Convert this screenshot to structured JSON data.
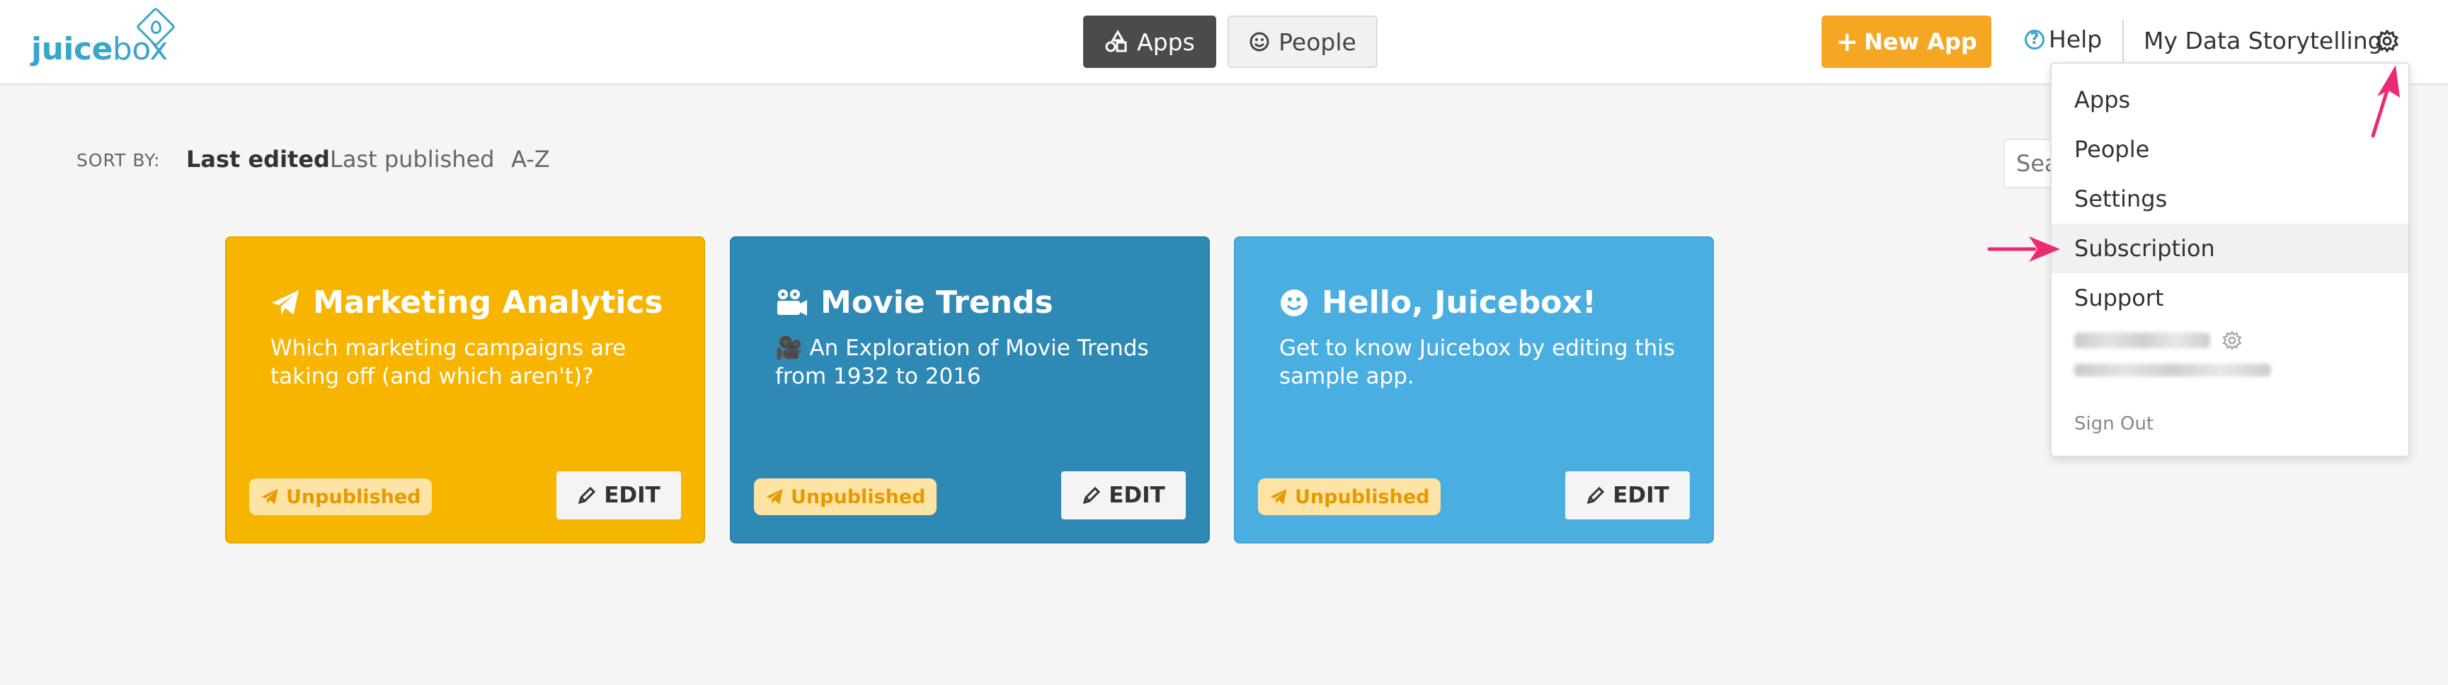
{
  "logo": {
    "part1": "juice",
    "part2": "box"
  },
  "nav": {
    "apps_label": "Apps",
    "people_label": "People"
  },
  "header": {
    "new_app_label": "New App",
    "help_label": "Help",
    "account_label": "My Data Storytelling"
  },
  "sort": {
    "label": "SORT BY:",
    "options": [
      "Last edited",
      "Last published",
      "A-Z"
    ],
    "active": "Last edited"
  },
  "search": {
    "placeholder": "Search"
  },
  "cards": [
    {
      "title": "Marketing Analytics",
      "icon": "paper-plane-icon",
      "description": "Which marketing campaigns are taking off (and which aren't)?",
      "status": "Unpublished",
      "edit_label": "EDIT",
      "color": "#f7b500"
    },
    {
      "title": "Movie Trends",
      "icon": "film-camera-icon",
      "description": "🎥 An Exploration of Movie Trends from 1932 to 2016",
      "status": "Unpublished",
      "edit_label": "EDIT",
      "color": "#2e89b5"
    },
    {
      "title": "Hello, Juicebox!",
      "icon": "smiley-icon",
      "description": "Get to know Juicebox by editing this sample app.",
      "status": "Unpublished",
      "edit_label": "EDIT",
      "color": "#4aaee0"
    }
  ],
  "dropdown": {
    "items": [
      "Apps",
      "People",
      "Settings",
      "Subscription",
      "Support"
    ],
    "highlighted": "Subscription",
    "sign_out_label": "Sign Out"
  },
  "colors": {
    "accent_orange": "#f5a623",
    "brand_blue": "#3aa6c9",
    "arrow_pink": "#ec2a74"
  }
}
